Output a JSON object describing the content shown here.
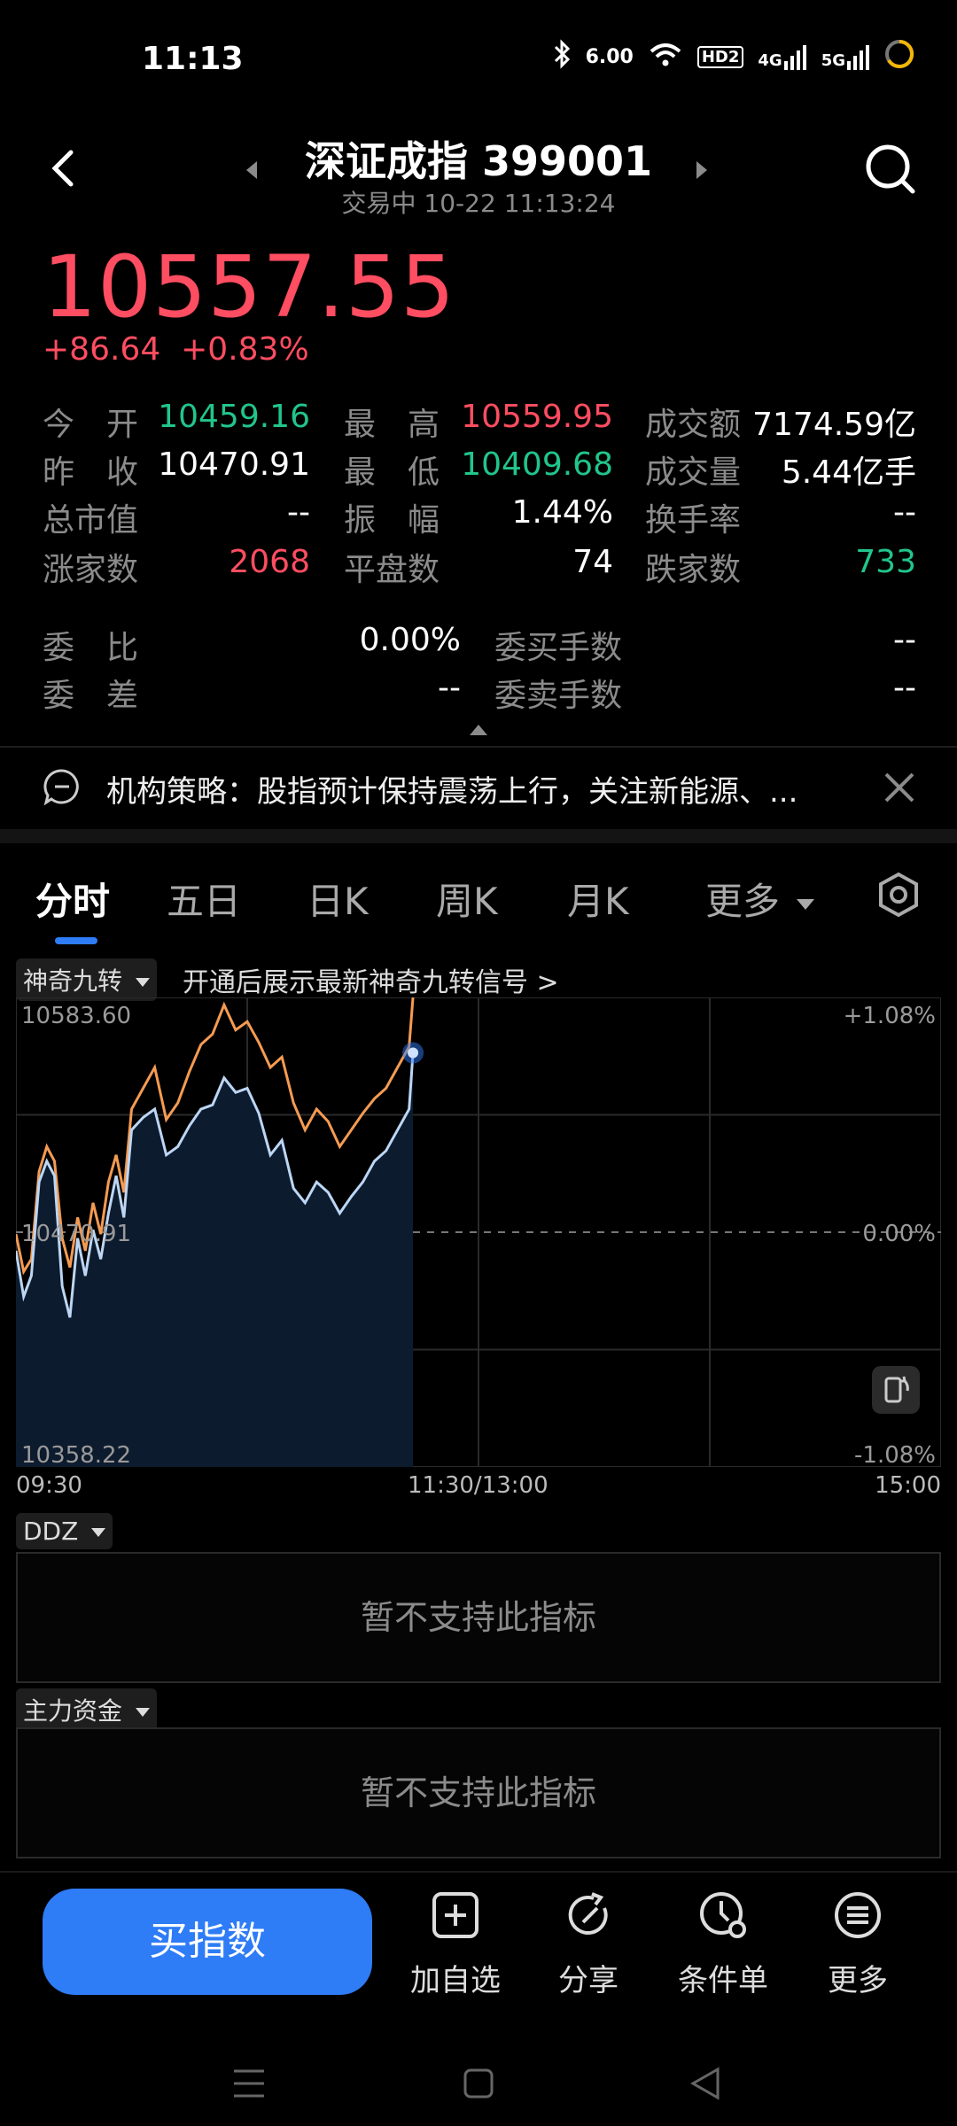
{
  "status_bar": {
    "time": "11:13",
    "speed": "6.00",
    "hd": "HD2",
    "net1": "4G",
    "net2": "5G"
  },
  "header": {
    "title": "深证成指 399001",
    "subtitle": "交易中 10-22 11:13:24"
  },
  "quote": {
    "price": "10557.55",
    "change": "+86.64",
    "change_pct": "+0.83%",
    "stats": [
      {
        "label": "今　开",
        "value": "10459.16",
        "color": "green"
      },
      {
        "label": "最　高",
        "value": "10559.95",
        "color": "red"
      },
      {
        "label": "成交额",
        "value": "7174.59亿",
        "color": "white"
      },
      {
        "label": "昨　收",
        "value": "10470.91",
        "color": "white"
      },
      {
        "label": "最　低",
        "value": "10409.68",
        "color": "green"
      },
      {
        "label": "成交量",
        "value": "5.44亿手",
        "color": "white"
      },
      {
        "label": "总市值",
        "value": "--",
        "color": "white"
      },
      {
        "label": "振　幅",
        "value": "1.44%",
        "color": "white"
      },
      {
        "label": "换手率",
        "value": "--",
        "color": "white"
      },
      {
        "label": "涨家数",
        "value": "2068",
        "color": "red"
      },
      {
        "label": "平盘数",
        "value": "74",
        "color": "white"
      },
      {
        "label": "跌家数",
        "value": "733",
        "color": "green"
      }
    ],
    "order": [
      {
        "label": "委　比",
        "value": "0.00%"
      },
      {
        "label": "委买手数",
        "value": "--"
      },
      {
        "label": "委　差",
        "value": "--"
      },
      {
        "label": "委卖手数",
        "value": "--"
      }
    ]
  },
  "news": {
    "text": "机构策略：股指预计保持震荡上行，关注新能源、..."
  },
  "tabs": [
    "分时",
    "五日",
    "日K",
    "周K",
    "月K",
    "更多"
  ],
  "indicator": {
    "selector": "神奇九转",
    "hint": "开通后展示最新神奇九转信号 >"
  },
  "chart": {
    "y_top": "10583.60",
    "y_mid": "10470.91",
    "y_bot": "10358.22",
    "pct_top": "+1.08%",
    "pct_mid": "0.00%",
    "pct_bot": "-1.08%",
    "x_start": "09:30",
    "x_mid": "11:30/13:00",
    "x_end": "15:00"
  },
  "chart_data": {
    "type": "line",
    "ylim": [
      10358.22,
      10583.6
    ],
    "x": [
      "09:30",
      "09:32",
      "09:34",
      "09:36",
      "09:38",
      "09:40",
      "09:42",
      "09:44",
      "09:46",
      "09:48",
      "09:50",
      "09:52",
      "09:54",
      "09:56",
      "09:58",
      "10:00",
      "10:03",
      "10:06",
      "10:09",
      "10:12",
      "10:15",
      "10:18",
      "10:21",
      "10:24",
      "10:27",
      "10:30",
      "10:33",
      "10:36",
      "10:39",
      "10:42",
      "10:45",
      "10:48",
      "10:51",
      "10:54",
      "10:57",
      "11:00",
      "11:03",
      "11:06",
      "11:09",
      "11:12",
      "11:13"
    ],
    "series": [
      {
        "values": [
          10470,
          10452,
          10458,
          10500,
          10512,
          10505,
          10468,
          10454,
          10478,
          10462,
          10485,
          10470,
          10495,
          10508,
          10490,
          10530,
          10540,
          10550,
          10525,
          10533,
          10548,
          10561,
          10566,
          10580,
          10568,
          10572,
          10562,
          10550,
          10555,
          10533,
          10520,
          10530,
          10524,
          10512,
          10520,
          10528,
          10535,
          10540,
          10550,
          10560,
          10590
        ]
      },
      {
        "values": [
          10462,
          10440,
          10450,
          10495,
          10505,
          10498,
          10445,
          10430,
          10468,
          10450,
          10472,
          10458,
          10480,
          10498,
          10478,
          10520,
          10526,
          10530,
          10508,
          10512,
          10522,
          10530,
          10532,
          10545,
          10538,
          10540,
          10528,
          10508,
          10515,
          10492,
          10485,
          10495,
          10490,
          10480,
          10488,
          10495,
          10505,
          10510,
          10520,
          10530,
          10557
        ]
      }
    ]
  },
  "ddz": {
    "label": "DDZ",
    "message": "暂不支持此指标"
  },
  "capital": {
    "label": "主力资金",
    "message": "暂不支持此指标"
  },
  "actions": {
    "buy": "买指数",
    "watch": "加自选",
    "share": "分享",
    "condition": "条件单",
    "more": "更多"
  },
  "colors": {
    "up": "#ff4d61",
    "down": "#22c58b",
    "accent": "#2e7cf6"
  }
}
